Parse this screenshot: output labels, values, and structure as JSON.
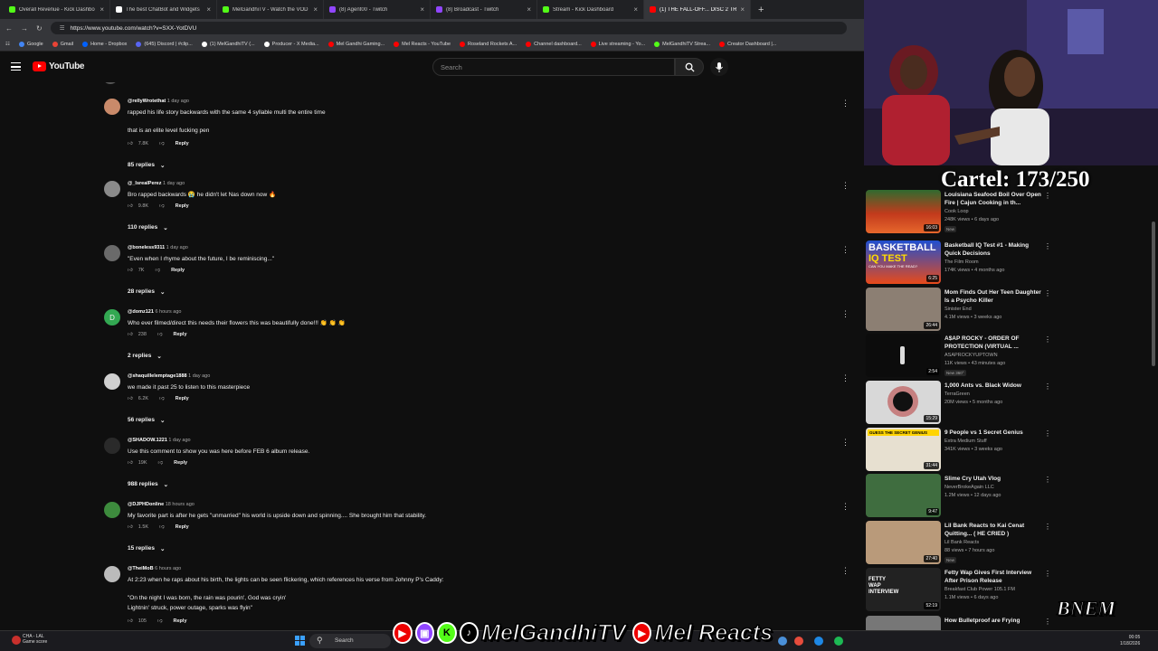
{
  "browser": {
    "tabs": [
      {
        "label": "Overall Revenue - Kick Dashbo",
        "color": "#53fc18",
        "active": false
      },
      {
        "label": "The best ChatBot and Widgets",
        "color": "#ffffff",
        "active": false
      },
      {
        "label": "MelGandhiTV - Watch the VOD",
        "color": "#53fc18",
        "active": false
      },
      {
        "label": "(8) Agent00 - Twitch",
        "color": "#9146ff",
        "active": false
      },
      {
        "label": "(8) Broadcast - Twitch",
        "color": "#9146ff",
        "active": false
      },
      {
        "label": "Stream - Kick Dashboard",
        "color": "#53fc18",
        "active": false
      },
      {
        "label": "(1) THE FALL-OFF... DISC 2 TRA",
        "color": "#ff0000",
        "active": true
      }
    ],
    "new_tab": "+",
    "url": "https://www.youtube.com/watch?v=SXX-YotDVU",
    "bookmarks": [
      {
        "label": "Google",
        "color": "#4285f4"
      },
      {
        "label": "Gmail",
        "color": "#ea4335"
      },
      {
        "label": "Home - Dropbox",
        "color": "#0061ff"
      },
      {
        "label": "(645) Discord | #clip...",
        "color": "#5865f2"
      },
      {
        "label": "(1) MelGandhiTV (...",
        "color": "#ffffff"
      },
      {
        "label": "Producer - X Media...",
        "color": "#ffffff"
      },
      {
        "label": "Mel Gandhi Gaming...",
        "color": "#ff0000"
      },
      {
        "label": "Mel Reacts - YouTube",
        "color": "#ff0000"
      },
      {
        "label": "Roseland Rockets A...",
        "color": "#ff0000"
      },
      {
        "label": "Channel dashboard...",
        "color": "#ff0000"
      },
      {
        "label": "Live streaming - Yo...",
        "color": "#ff0000"
      },
      {
        "label": "MelGandhiTV Strea...",
        "color": "#53fc18"
      },
      {
        "label": "Creator Dashboard |...",
        "color": "#ff0000"
      }
    ]
  },
  "youtube": {
    "logo": "YouTube",
    "search_placeholder": "Search"
  },
  "comments": [
    {
      "user": "@rellyWrotethat",
      "time": "1 day ago",
      "lines": [
        "rapped his life story backwards with the same 4 syllable multi the entire time",
        "",
        "that is an elite level fucking pen"
      ],
      "likes": "7.8K",
      "replies": "85 replies",
      "avatar": "#c98a6a"
    },
    {
      "user": "@_IsrealPerez",
      "time": "1 day ago",
      "lines": [
        "Bro rapped backwards 😭 he didn't let Nas down now 🔥"
      ],
      "likes": "9.8K",
      "replies": "110 replies",
      "avatar": "#8a8a8a"
    },
    {
      "user": "@boneless9311",
      "time": "1 day ago",
      "lines": [
        "\"Even when I rhyme about the future, I be reminiscing...\""
      ],
      "likes": "7K",
      "replies": "28 replies",
      "avatar": "#6a6a6a"
    },
    {
      "user": "@domz121",
      "time": "6 hours ago",
      "lines": [
        "Who ever filmed/direct this needs their flowers this was beautifully done!!! 👏 👏 👏"
      ],
      "likes": "238",
      "replies": "2 replies",
      "avatar": "#33a852",
      "initial": "D"
    },
    {
      "user": "@shaquillelemptage1888",
      "time": "1 day ago",
      "lines": [
        "we made it past 25 to listen to this masterpiece"
      ],
      "likes": "6.2K",
      "replies": "56 replies",
      "avatar": "#d0d0d0"
    },
    {
      "user": "@SHADOW.1221",
      "time": "1 day ago",
      "lines": [
        "Use this comment to show you was here before FEB 6 album release."
      ],
      "likes": "19K",
      "replies": "988 replies",
      "avatar": "#2a2a2a"
    },
    {
      "user": "@DJPHDonline",
      "time": "18 hours ago",
      "lines": [
        "My favorite part is after he gets \"unmarried\" his world is upside down and spinning.... She brought him that stability."
      ],
      "likes": "1.5K",
      "replies": "15 replies",
      "avatar": "#3d8b3d"
    },
    {
      "user": "@TheiMoB",
      "time": "6 hours ago",
      "lines": [
        "At 2:23 when he raps about his birth, the lights can be seen flickering, which references his verse from Johnny P's Caddy:",
        "",
        "\"On the night I was born, the rain was pourin', God was cryin'",
        "Lightnin' struck, power outage, sparks was flyin\""
      ],
      "likes": "105",
      "replies": "",
      "avatar": "#bbbbbb"
    }
  ],
  "reply_label": "Reply",
  "overlay_counter": "Cartel: 173/250",
  "recommended": [
    {
      "title": "Louisiana Seafood Boil Over Open Fire | Cajun Cooking in th...",
      "channel": "Cook Loop",
      "views": "248K views • 6 days ago",
      "duration": "16:03",
      "badge": "New",
      "color": "#c0391f"
    },
    {
      "title": "Basketball IQ Test #1 - Making Quick Decisions",
      "channel": "The Film Room",
      "views": "174K views • 4 months ago",
      "duration": "6:25",
      "badge": "",
      "color": "#2d5fd6"
    },
    {
      "title": "Mom Finds Out Her Teen Daughter Is a Psycho Killer",
      "channel": "Sinister End",
      "views": "4.1M views • 3 weeks ago",
      "duration": "26:44",
      "badge": "",
      "color": "#8c7f73"
    },
    {
      "title": "A$AP ROCKY - ORDER OF PROTECTION (VIRTUAL ...",
      "channel": "ASAPROCKYUPTOWN",
      "views": "11K views • 43 minutes ago",
      "duration": "2:54",
      "badge": "New  360°",
      "color": "#0c0c0c"
    },
    {
      "title": "1,000 Ants vs. Black Widow",
      "channel": "TerraGreen",
      "views": "20M views • 5 months ago",
      "duration": "15:29",
      "badge": "",
      "color": "#d8d8d8"
    },
    {
      "title": "9 People vs 1 Secret Genius",
      "channel": "Extra Medium Stuff",
      "views": "341K views • 3 weeks ago",
      "duration": "31:44",
      "badge": "",
      "color": "#e7e0d0"
    },
    {
      "title": "Slime Cry Utah Vlog",
      "channel": "NeverBrokeAgain LLC",
      "views": "1.2M views • 12 days ago",
      "duration": "9:47",
      "badge": "",
      "color": "#3f6d3f"
    },
    {
      "title": "Lil Bank Reacts to Kai Cenat Quitting... ( HE CRIED )",
      "channel": "Lil Bank Reacts",
      "views": "88 views • 7 hours ago",
      "duration": "27:40",
      "badge": "New",
      "color": "#b99a7a"
    },
    {
      "title": "Fetty Wap Gives First Interview After Prison Release",
      "channel": "Breakfast Club Power 105.1 FM",
      "views": "1.1M views • 6 days ago",
      "duration": "52:19",
      "badge": "",
      "color": "#222222"
    },
    {
      "title": "How Bulletproof are Frying",
      "channel": "",
      "views": "",
      "duration": "",
      "badge": "",
      "color": "#777777"
    }
  ],
  "thumb_texts": {
    "bball1": "BASKETBALL",
    "bball2": "IQ TEST",
    "bball3": "CAN YOU MAKE THE READ?",
    "genius": "GUESS THE SECRET GENIUS",
    "fetty": "FETTY WAP INTERVIEW"
  },
  "taskbar": {
    "weather_temp": "CHA - LAL",
    "weather_desc": "Game score",
    "search": "Search",
    "time": "00:05",
    "date": "1/18/2026"
  },
  "stream_overlay": {
    "brand1": "MelGandhiTV",
    "brand2": "Mel Reacts",
    "bnem": "BNEM"
  }
}
